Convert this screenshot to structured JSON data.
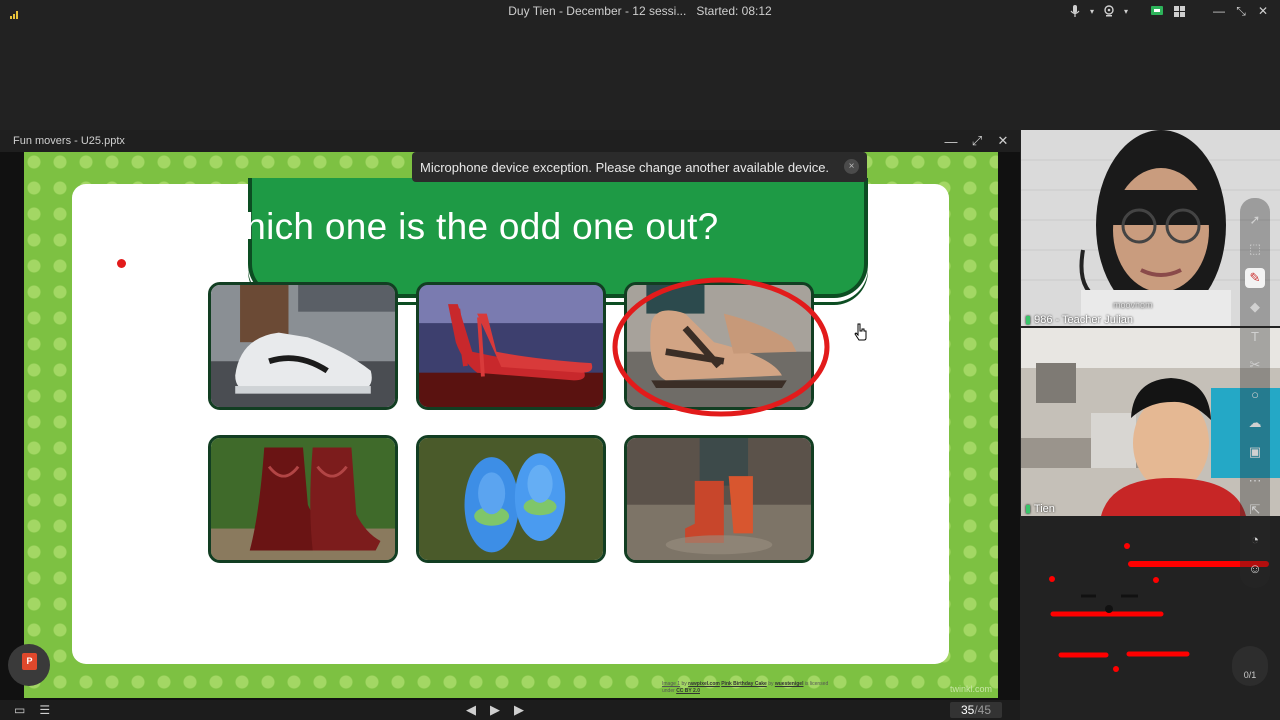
{
  "app": {
    "window_title": "Duy Tien - December - 12 sessi...",
    "started_label": "Started: 08:12"
  },
  "presentation": {
    "file_title": "Fun movers - U25.pptx",
    "slide_heading": "Which one is the odd one out?",
    "credit": {
      "image_label": "Image 1",
      "by1": "by",
      "source1": "rawpixel.com",
      "image2": "Pink Birthday Cake",
      "by2": "by",
      "author2": "wuestenigel",
      "licensed": "is licensed",
      "under": "under",
      "license": "CC BY 2.0"
    },
    "watermark": "twinkl.com",
    "page_current": "35",
    "page_total": "/45",
    "items": [
      {
        "name": "sneaker"
      },
      {
        "name": "high-heels"
      },
      {
        "name": "sandals",
        "circled": true
      },
      {
        "name": "cowboy-boots"
      },
      {
        "name": "slippers"
      },
      {
        "name": "rain-boots"
      }
    ]
  },
  "toast": {
    "message": "Microphone device exception. Please change another available device.",
    "close_glyph": "×"
  },
  "participants": [
    {
      "label": "986 - Teacher Julian",
      "overlay": "moovnom"
    },
    {
      "label": "Tien"
    }
  ],
  "fab": {
    "label": "P"
  },
  "tool_counter": {
    "label": "0/1"
  },
  "icons": {
    "signal": "signal-icon",
    "mic": "microphone-icon",
    "camera": "webcam-icon",
    "share": "screen-share-icon",
    "grid": "grid-icon",
    "minimize": "minimize-icon",
    "fullscreen": "fullscreen-icon",
    "close": "close-icon"
  },
  "colors": {
    "slide_green": "#7dc142",
    "banner_green": "#1e9a45",
    "circle_red": "#e21b1b",
    "annotation_red": "#ff0000",
    "toolbar_bg": "#222222"
  }
}
